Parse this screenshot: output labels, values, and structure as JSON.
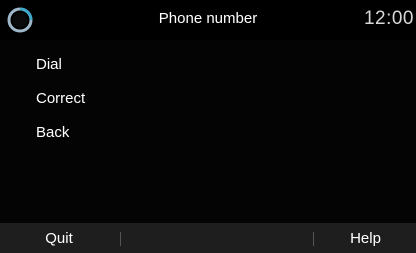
{
  "header": {
    "title": "Phone number",
    "clock": "12:00",
    "icon": "circle-logo-icon"
  },
  "menu": {
    "items": [
      {
        "label": "Dial"
      },
      {
        "label": "Correct"
      },
      {
        "label": "Back"
      }
    ]
  },
  "bottom_bar": {
    "quit_label": "Quit",
    "help_label": "Help"
  },
  "colors": {
    "background": "#050505",
    "bar": "#1e1e1e",
    "text": "#ffffff",
    "icon_ring": "#9fb7c8",
    "icon_accent": "#3fa7c9"
  }
}
